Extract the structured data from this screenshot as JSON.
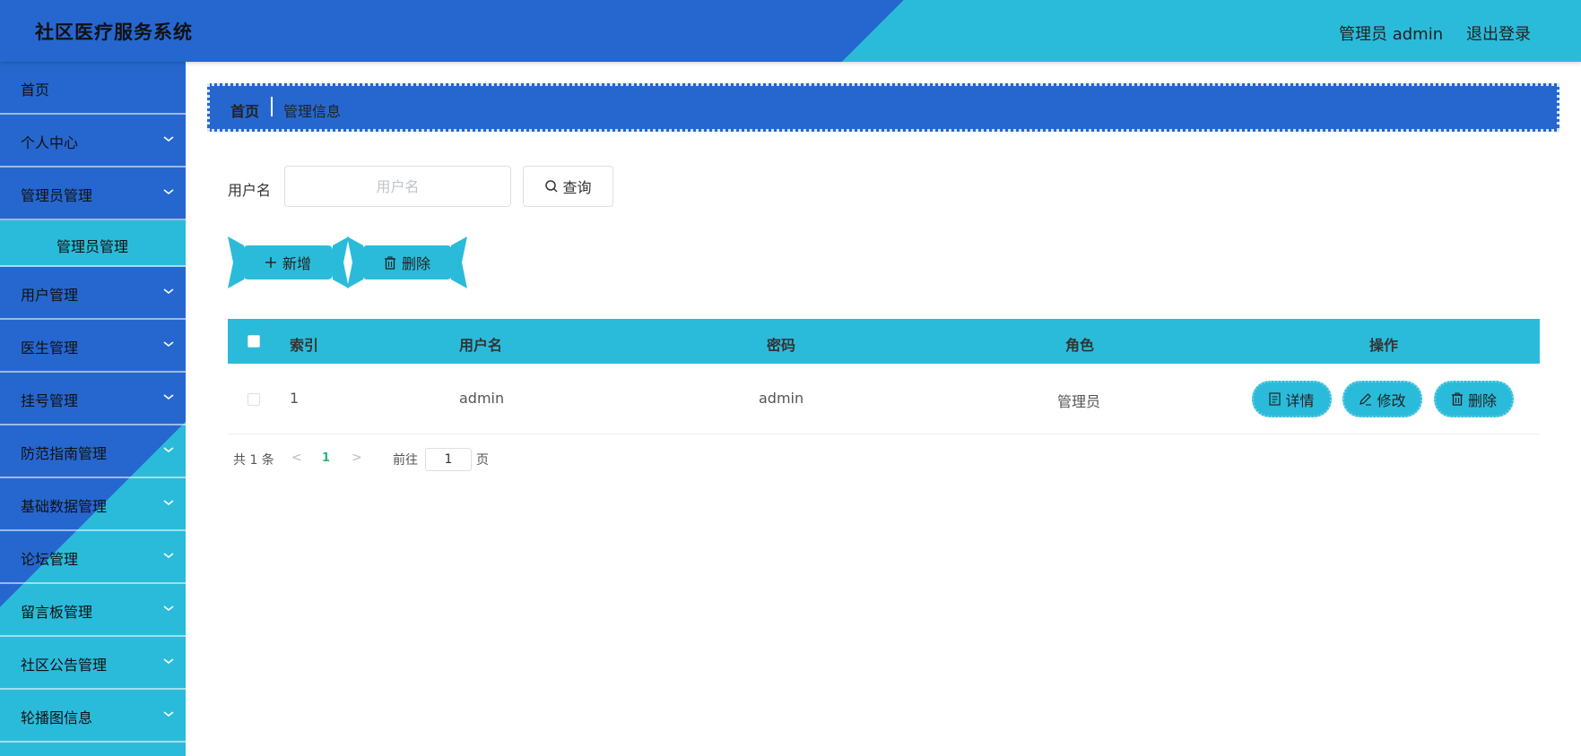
{
  "app": {
    "title": "社区医疗服务系统"
  },
  "header": {
    "user_label": "管理员 admin",
    "logout_label": "退出登录"
  },
  "sidebar": {
    "items": [
      {
        "label": "首页",
        "has_children": false
      },
      {
        "label": "个人中心",
        "has_children": true
      },
      {
        "label": "管理员管理",
        "has_children": true,
        "expanded": true
      },
      {
        "label": "用户管理",
        "has_children": true
      },
      {
        "label": "医生管理",
        "has_children": true
      },
      {
        "label": "挂号管理",
        "has_children": true
      },
      {
        "label": "防范指南管理",
        "has_children": true
      },
      {
        "label": "基础数据管理",
        "has_children": true
      },
      {
        "label": "论坛管理",
        "has_children": true
      },
      {
        "label": "留言板管理",
        "has_children": true
      },
      {
        "label": "社区公告管理",
        "has_children": true
      },
      {
        "label": "轮播图信息",
        "has_children": true
      }
    ],
    "active_submenu": "管理员管理"
  },
  "breadcrumb": {
    "home": "首页",
    "current": "管理信息"
  },
  "search": {
    "label": "用户名",
    "placeholder": "用户名",
    "value": "",
    "button": "查询"
  },
  "actions": {
    "add": "新增",
    "delete": "删除"
  },
  "table": {
    "columns": [
      "索引",
      "用户名",
      "密码",
      "角色",
      "操作"
    ],
    "rows": [
      {
        "index": "1",
        "username": "admin",
        "password": "admin",
        "role": "管理员"
      }
    ],
    "row_actions": {
      "detail": "详情",
      "edit": "修改",
      "delete": "删除"
    }
  },
  "pagination": {
    "total_text": "共 1 条",
    "current_page": "1",
    "goto_label": "前往",
    "goto_value": "1",
    "page_suffix": "页"
  },
  "colors": {
    "primary_blue": "#2667cf",
    "accent_cyan": "#2bbbda",
    "pager_active": "#2bb673"
  }
}
